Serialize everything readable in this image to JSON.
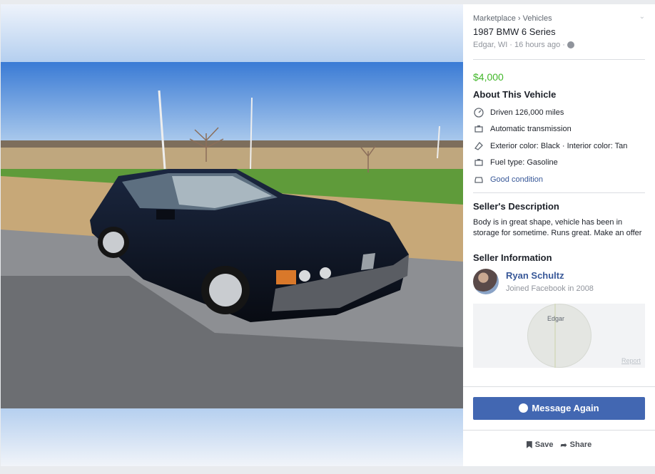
{
  "breadcrumb": {
    "root": "Marketplace",
    "separator": "›",
    "category": "Vehicles"
  },
  "listing": {
    "title": "1987 BMW 6 Series",
    "location": "Edgar, WI",
    "posted": "16 hours ago",
    "dot": "·",
    "price": "$4,000"
  },
  "about": {
    "heading": "About This Vehicle",
    "items": [
      {
        "icon": "speedometer-icon",
        "text": "Driven 126,000 miles"
      },
      {
        "icon": "engine-icon",
        "text": "Automatic transmission"
      },
      {
        "icon": "paint-icon",
        "text": "Exterior color: Black · Interior color: Tan"
      },
      {
        "icon": "fuel-icon",
        "text": "Fuel type: Gasoline"
      },
      {
        "icon": "car-icon",
        "text": "Good condition"
      }
    ]
  },
  "description": {
    "heading": "Seller's Description",
    "text": "Body is in great shape, vehicle has been in storage for sometime.  Runs great. Make an offer"
  },
  "seller": {
    "heading": "Seller Information",
    "name": "Ryan Schultz",
    "joined": "Joined Facebook in 2008"
  },
  "map": {
    "label": "Edgar",
    "report": "Report"
  },
  "buttons": {
    "message": "Message Again",
    "save": "Save",
    "share": "Share"
  },
  "colors": {
    "price": "#42b72a",
    "button": "#4267b2",
    "link": "#385898"
  }
}
